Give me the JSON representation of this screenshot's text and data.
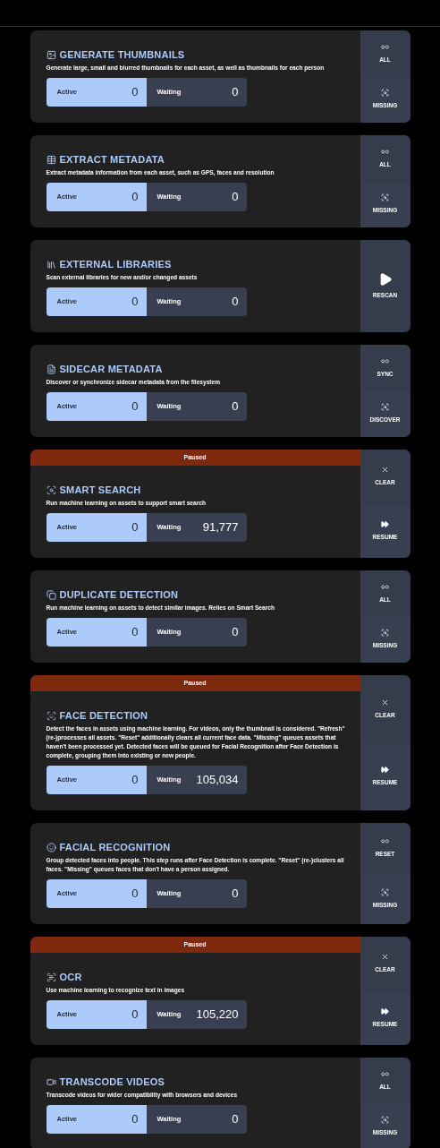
{
  "jobs": [
    {
      "kind": "thumbnail",
      "title": "GENERATE THUMBNAILS",
      "description": "Generate large, small and blurred thumbnails for each asset, as well as thumbnails for each person",
      "active_label": "Active",
      "active": "0",
      "waiting_label": "Waiting",
      "waiting": "0",
      "actions": [
        {
          "kind": "all",
          "label": "ALL"
        },
        {
          "kind": "missing",
          "label": "MISSING"
        }
      ]
    },
    {
      "kind": "table",
      "title": "EXTRACT METADATA",
      "description": "Extract metadata information from each asset, such as GPS, faces and resolution",
      "active_label": "Active",
      "active": "0",
      "waiting_label": "Waiting",
      "waiting": "0",
      "actions": [
        {
          "kind": "all",
          "label": "ALL"
        },
        {
          "kind": "missing",
          "label": "MISSING"
        }
      ]
    },
    {
      "kind": "library",
      "title": "EXTERNAL LIBRARIES",
      "description": "Scan external libraries for new and/or changed assets",
      "active_label": "Active",
      "active": "0",
      "waiting_label": "Waiting",
      "waiting": "0",
      "actions": [
        {
          "kind": "rescan",
          "label": "RESCAN"
        }
      ]
    },
    {
      "kind": "sidecar",
      "title": "SIDECAR METADATA",
      "description": "Discover or synchronize sidecar metadata from the filesystem",
      "active_label": "Active",
      "active": "0",
      "waiting_label": "Waiting",
      "waiting": "0",
      "actions": [
        {
          "kind": "all",
          "label": "SYNC"
        },
        {
          "kind": "missing",
          "label": "DISCOVER"
        }
      ]
    },
    {
      "kind": "smart",
      "banner": "Paused",
      "title": "SMART SEARCH",
      "description": "Run machine learning on assets to support smart search",
      "active_label": "Active",
      "active": "0",
      "waiting_label": "Waiting",
      "waiting": "91,777",
      "actions": [
        {
          "kind": "clear",
          "label": "CLEAR"
        },
        {
          "kind": "resume",
          "label": "RESUME"
        }
      ]
    },
    {
      "kind": "duplicate",
      "title": "DUPLICATE DETECTION",
      "description": "Run machine learning on assets to detect similar images. Relies on Smart Search",
      "active_label": "Active",
      "active": "0",
      "waiting_label": "Waiting",
      "waiting": "0",
      "actions": [
        {
          "kind": "all",
          "label": "ALL"
        },
        {
          "kind": "missing",
          "label": "MISSING"
        }
      ]
    },
    {
      "kind": "face",
      "banner": "Paused",
      "title": "FACE DETECTION",
      "description": "Detect the faces in assets using machine learning. For videos, only the thumbnail is considered. \"Refresh\" (re-)processes all assets. \"Reset\" additionally clears all current face data. \"Missing\" queues assets that haven't been processed yet. Detected faces will be queued for Facial Recognition after Face Detection is complete, grouping them into existing or new people.",
      "active_label": "Active",
      "active": "0",
      "waiting_label": "Waiting",
      "waiting": "105,034",
      "actions": [
        {
          "kind": "clear",
          "label": "CLEAR"
        },
        {
          "kind": "resume",
          "label": "RESUME"
        }
      ]
    },
    {
      "kind": "recognition",
      "title": "FACIAL RECOGNITION",
      "description": "Group detected faces into people. This step runs after Face Detection is complete. \"Reset\" (re-)clusters all faces. \"Missing\" queues faces that don't have a person assigned.",
      "active_label": "Active",
      "active": "0",
      "waiting_label": "Waiting",
      "waiting": "0",
      "actions": [
        {
          "kind": "all",
          "label": "RESET"
        },
        {
          "kind": "missing",
          "label": "MISSING"
        }
      ]
    },
    {
      "kind": "ocr",
      "banner": "Paused",
      "title": "OCR",
      "description": "Use machine learning to recognize text in images",
      "active_label": "Active",
      "active": "0",
      "waiting_label": "Waiting",
      "waiting": "105,220",
      "actions": [
        {
          "kind": "clear",
          "label": "CLEAR"
        },
        {
          "kind": "resume",
          "label": "RESUME"
        }
      ]
    },
    {
      "kind": "video",
      "title": "TRANSCODE VIDEOS",
      "description": "Transcode videos for wider compatibility with browsers and devices",
      "active_label": "Active",
      "active": "0",
      "waiting_label": "Waiting",
      "waiting": "0",
      "actions": [
        {
          "kind": "all",
          "label": "ALL"
        },
        {
          "kind": "missing",
          "label": "MISSING"
        }
      ]
    }
  ]
}
